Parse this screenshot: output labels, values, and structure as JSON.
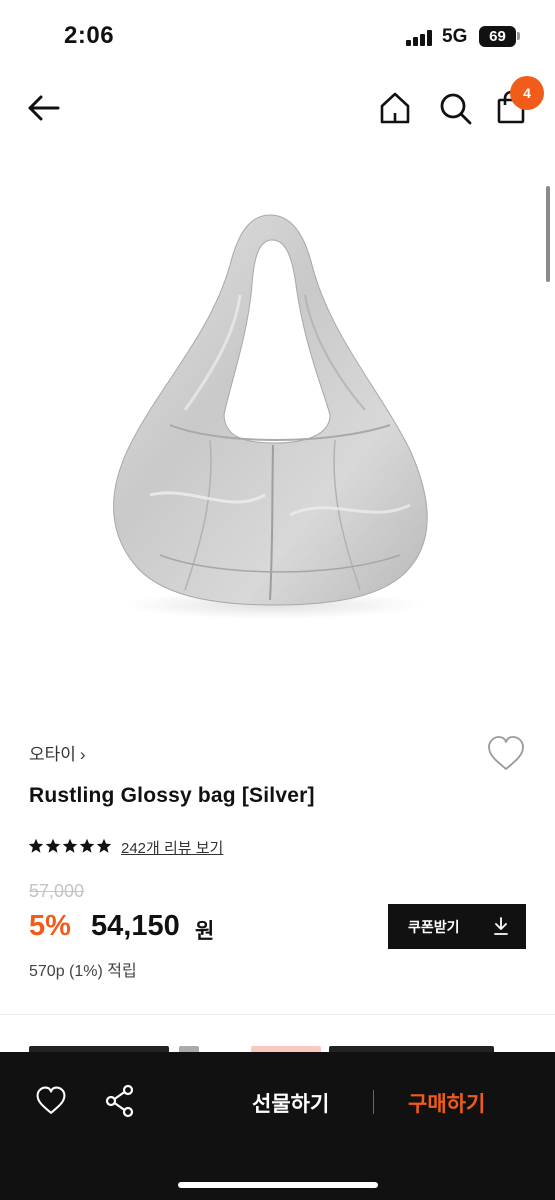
{
  "status_bar": {
    "time": "2:06",
    "network": "5G",
    "battery": "69"
  },
  "nav": {
    "cart_count": "4"
  },
  "product": {
    "brand": "오타이",
    "brand_chevron": "›",
    "title": "Rustling Glossy bag [Silver]",
    "rating": 5,
    "review_link": "242개 리뷰 보기",
    "original_price": "57,000",
    "discount": "5%",
    "sale_price": "54,150",
    "currency": "원",
    "points": "570p (1%) 적립",
    "coupon_label": "쿠폰받기"
  },
  "bottom_bar": {
    "gift_label": "선물하기",
    "buy_label": "구매하기"
  },
  "colors": {
    "accent": "#f25c1a",
    "dark": "#111111",
    "muted": "#c4c4c4"
  },
  "icons": [
    "back-arrow-icon",
    "home-icon",
    "search-icon",
    "bag-icon",
    "heart-icon",
    "star-icon",
    "download-icon",
    "share-icon"
  ]
}
